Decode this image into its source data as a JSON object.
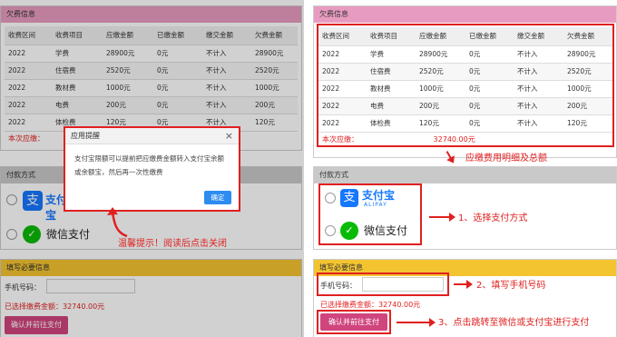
{
  "colors": {
    "accent_red": "#e02020",
    "pink_header": "#e89bc0",
    "grey_header": "#c9c9c9",
    "yellow_header": "#f4c430",
    "pay_button": "#d0457d",
    "alipay_blue": "#1677ff",
    "wechat_green": "#09bb07"
  },
  "arrears": {
    "title": "欠费信息",
    "columns": [
      "收费区间",
      "收费项目",
      "应缴金额",
      "已缴金额",
      "缴交金额",
      "欠费金额"
    ],
    "rows": [
      [
        "2022",
        "学费",
        "28900元",
        "0元",
        "不计入",
        "28900元"
      ],
      [
        "2022",
        "住宿费",
        "2520元",
        "0元",
        "不计入",
        "2520元"
      ],
      [
        "2022",
        "教材费",
        "1000元",
        "0元",
        "不计入",
        "1000元"
      ],
      [
        "2022",
        "电费",
        "200元",
        "0元",
        "不计入",
        "200元"
      ],
      [
        "2022",
        "体检费",
        "120元",
        "0元",
        "不计入",
        "120元"
      ]
    ],
    "total_label": "本次应缴：",
    "total_value": "32740.00元"
  },
  "payment": {
    "title": "付款方式",
    "alipay_text": "支付宝",
    "alipay_sub": "ALIPAY",
    "wechat_text": "微信支付"
  },
  "form": {
    "title": "填写必要信息",
    "phone_label": "手机号码：",
    "phone_value": "",
    "selected_amount": "已选择缴费金额：32740.00元",
    "submit_label": "确认并前往支付"
  },
  "modal": {
    "title": "应用提醒",
    "close": "×",
    "body": "支付宝限额可以提前把应缴费金额转入支付宝余额或余额宝，然后再一次性缴费",
    "ok_label": "确定"
  },
  "annotations": {
    "left_hint": "温馨提示！阅读后点击关闭",
    "detail": "应缴费用明细及总额",
    "step1": "1、选择支付方式",
    "step2": "2、填写手机号码",
    "step3": "3、点击跳转至微信或支付宝进行支付"
  }
}
